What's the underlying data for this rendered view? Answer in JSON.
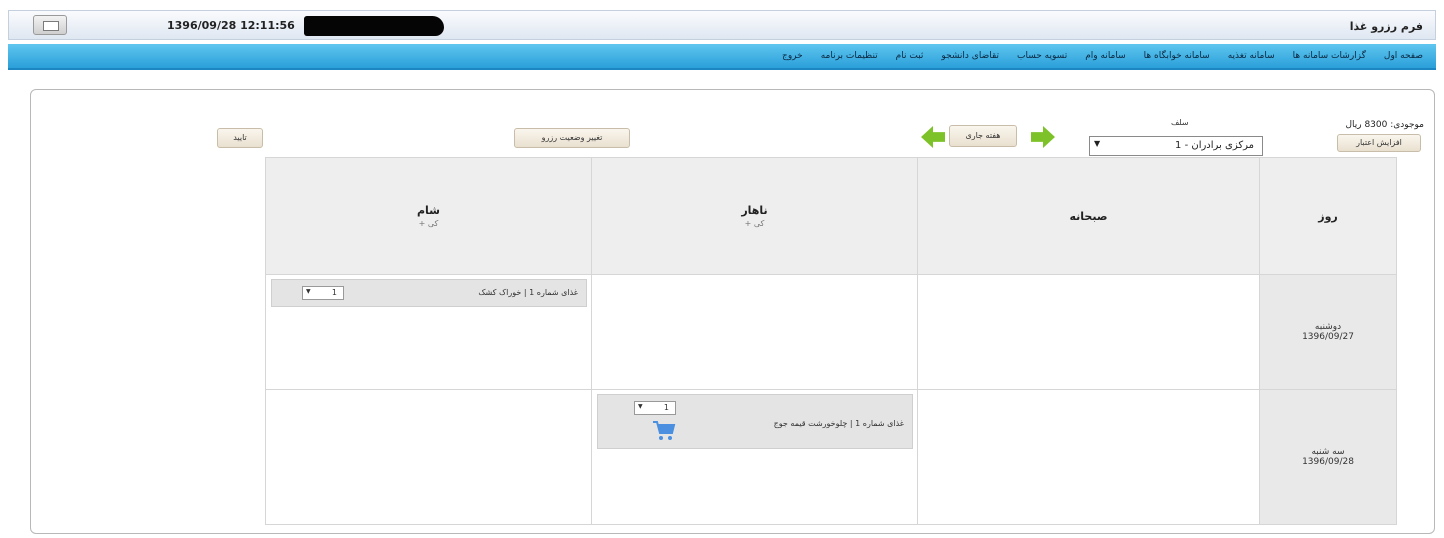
{
  "header": {
    "datetime": "1396/09/28 12:11:56",
    "app_title": "فرم رزرو غذا"
  },
  "nav": {
    "items": [
      "صفحه اول",
      "گزارشات سامانه ها",
      "سامانه تغذیه",
      "سامانه خوابگاه ها",
      "سامانه وام",
      "تسویه حساب",
      "تقاضای دانشجو",
      "ثبت نام",
      "تنظیمات برنامه",
      "خروج"
    ]
  },
  "toolbar": {
    "credit_label": "موجودی: 8300 ریال",
    "increase_credit": "افزایش اعتبار",
    "self_label": "سلف",
    "self_value": "مرکزی برادران - 1",
    "current_week": "هفته جاری",
    "change_reserve_status": "تغییر وضعیت رزرو",
    "confirm": "تایید"
  },
  "table": {
    "headers": {
      "day": "روز",
      "breakfast": "صبحانه",
      "lunch": "ناهار",
      "dinner": "شام"
    },
    "meal_sub": "+ کی",
    "rows": [
      {
        "day_name": "دوشنبه",
        "date": "1396/09/27",
        "dinner": {
          "text": "غذای شماره 1 | خوراک کشک",
          "qty": "1"
        }
      },
      {
        "day_name": "سه شنبه",
        "date": "1396/09/28",
        "lunch": {
          "text": "غذای شماره 1 | چلوخورشت قیمه جوج",
          "qty": "1"
        }
      }
    ]
  },
  "colors": {
    "nav_blue": "#2a9fd9",
    "arrow_green": "#7ec22a",
    "cart_blue": "#4a8fe0"
  }
}
